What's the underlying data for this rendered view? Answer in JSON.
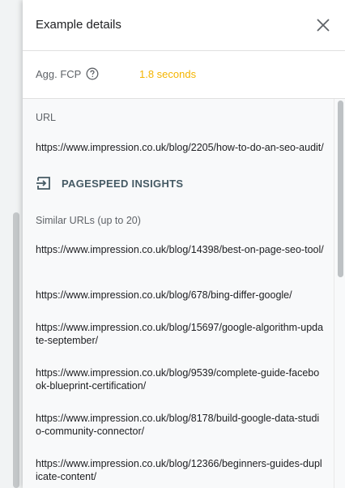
{
  "header": {
    "title": "Example details"
  },
  "metric": {
    "label": "Agg. FCP",
    "value": "1.8 seconds"
  },
  "url_section": {
    "label": "URL",
    "url": "https://www.impression.co.uk/blog/2205/how-to-do-an-seo-audit/",
    "action_label": "PAGESPEED INSIGHTS"
  },
  "similar": {
    "label": "Similar URLs (up to 20)",
    "urls": [
      "https://www.impression.co.uk/blog/14398/best-on-page-seo-tool/",
      "https://www.impression.co.uk/blog/678/bing-differ-google/",
      "https://www.impression.co.uk/blog/15697/google-algorithm-update-september/",
      "https://www.impression.co.uk/blog/9539/complete-guide-facebook-blueprint-certification/",
      "https://www.impression.co.uk/blog/8178/build-google-data-studio-community-connector/",
      "https://www.impression.co.uk/blog/12366/beginners-guides-duplicate-content/"
    ]
  },
  "colors": {
    "metric_value": "#f4b400",
    "link": "#455a64"
  }
}
